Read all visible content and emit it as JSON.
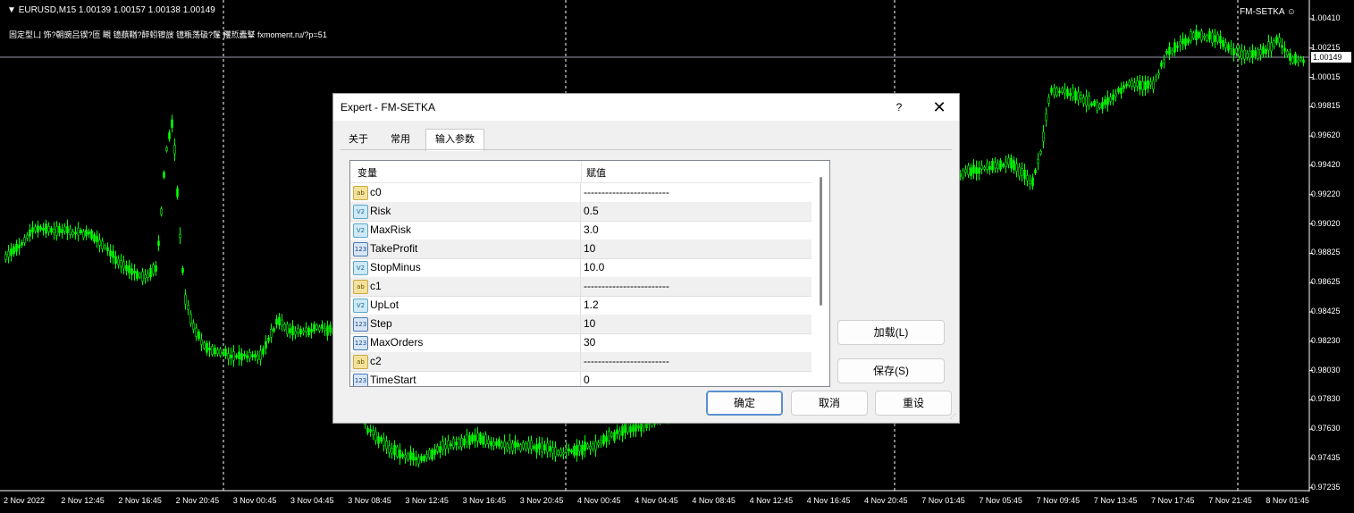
{
  "chart": {
    "symbol_header": "EURUSD,M15  1.00139 1.00157 1.00138 1.00149",
    "ea_comment": "固定型凵 饰?朝豌吕锲?匝 瞡    镱蕻鞧?醉蚓镲詜 镱粻荡砐?鬔 矡焎蠹鞤 fxmoment.ru/?p=51",
    "ea_name": "FM-SETKA ☺",
    "current_price": "1.00149",
    "price_labels": [
      "1.00410",
      "1.00215",
      "1.00015",
      "0.99815",
      "0.99620",
      "0.99420",
      "0.99220",
      "0.99020",
      "0.98825",
      "0.98625",
      "0.98425",
      "0.98230",
      "0.98030",
      "0.97830",
      "0.97630",
      "0.97435",
      "0.97235"
    ],
    "time_labels": [
      "2 Nov 2022",
      "2 Nov 12:45",
      "2 Nov 16:45",
      "2 Nov 20:45",
      "3 Nov 00:45",
      "3 Nov 04:45",
      "3 Nov 08:45",
      "3 Nov 12:45",
      "3 Nov 16:45",
      "3 Nov 20:45",
      "4 Nov 00:45",
      "4 Nov 04:45",
      "4 Nov 08:45",
      "4 Nov 12:45",
      "4 Nov 16:45",
      "4 Nov 20:45",
      "7 Nov 01:45",
      "7 Nov 05:45",
      "7 Nov 09:45",
      "7 Nov 13:45",
      "7 Nov 17:45",
      "7 Nov 21:45",
      "8 Nov 01:45"
    ],
    "candle_color": "#00ff00",
    "background": "#000000"
  },
  "dialog": {
    "title": "Expert - FM-SETKA",
    "help": "?",
    "close": "✕",
    "tabs": [
      {
        "label": "关于"
      },
      {
        "label": "常用"
      },
      {
        "label": "输入参数"
      }
    ],
    "table": {
      "col_variable": "变量",
      "col_value": "赋值",
      "rows": [
        {
          "name": "c0",
          "value": "------------------------",
          "type": "ab",
          "icon_text": "ab"
        },
        {
          "name": "Risk",
          "value": "0.5",
          "type": "dbl",
          "icon_text": "V2"
        },
        {
          "name": "MaxRisk",
          "value": "3.0",
          "type": "dbl",
          "icon_text": "V2"
        },
        {
          "name": "TakeProfit",
          "value": "10",
          "type": "int",
          "icon_text": "123"
        },
        {
          "name": "StopMinus",
          "value": "10.0",
          "type": "dbl",
          "icon_text": "V2"
        },
        {
          "name": "c1",
          "value": "------------------------",
          "type": "ab",
          "icon_text": "ab"
        },
        {
          "name": "UpLot",
          "value": "1.2",
          "type": "dbl",
          "icon_text": "V2"
        },
        {
          "name": "Step",
          "value": "10",
          "type": "int",
          "icon_text": "123"
        },
        {
          "name": "MaxOrders",
          "value": "30",
          "type": "int",
          "icon_text": "123"
        },
        {
          "name": "c2",
          "value": "------------------------",
          "type": "ab",
          "icon_text": "ab"
        },
        {
          "name": "TimeStart",
          "value": "0",
          "type": "int",
          "icon_text": "123"
        }
      ]
    },
    "buttons": {
      "load": "加载(L)",
      "save": "保存(S)",
      "ok": "确定",
      "cancel": "取消",
      "reset": "重设"
    }
  }
}
